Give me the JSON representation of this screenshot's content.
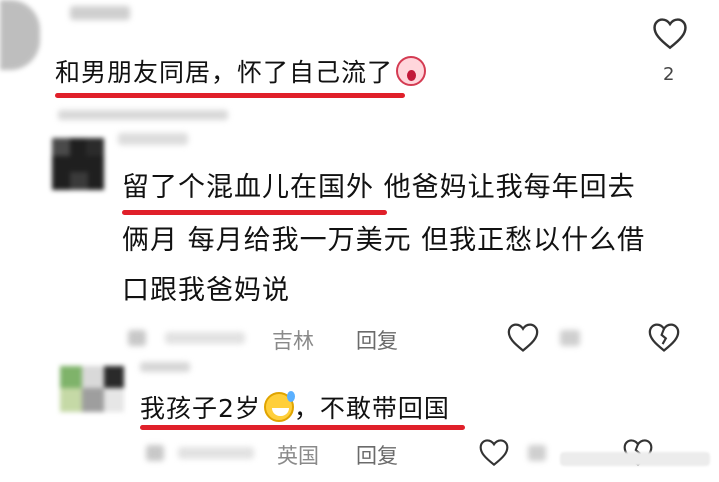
{
  "comments": [
    {
      "text": "和男朋友同居，怀了自己流了",
      "emoji": "scream-emoji",
      "likes": "2"
    },
    {
      "lines": [
        "留了个混血儿在国外 他爸妈让我每年回去",
        "俩月 每月给我一万美元 但我正愁以什么借",
        "口跟我爸妈说"
      ],
      "location": "吉林",
      "reply_label": "回复"
    },
    {
      "text": "我孩子2岁",
      "text_after_emoji": "，不敢带回国",
      "emoji": "grinning-sweat-emoji",
      "location": "英国",
      "reply_label": "回复"
    }
  ],
  "colors": {
    "highlight_underline": "#e0202a",
    "text": "#111111",
    "meta": "#8a8a8a",
    "icon": "#333333"
  },
  "icons": [
    "heart-icon",
    "broken-heart-icon"
  ]
}
